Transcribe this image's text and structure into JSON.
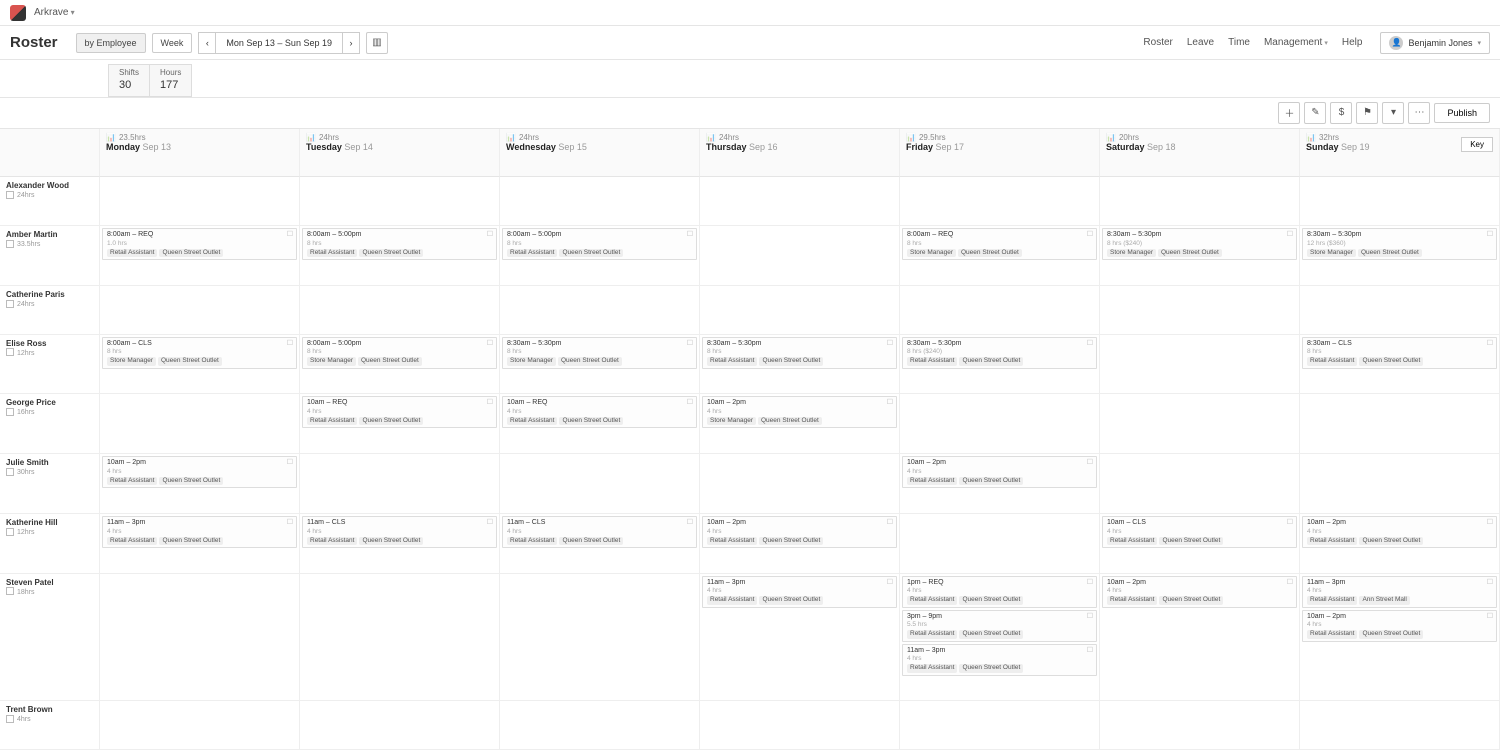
{
  "app": {
    "org": "Arkrave"
  },
  "nav": {
    "title": "Roster",
    "view_by": "by Employee",
    "period": "Week",
    "range": "Mon Sep 13 – Sun Sep 19",
    "links": [
      "Roster",
      "Leave",
      "Time",
      "Management",
      "Help"
    ],
    "user": "Benjamin Jones"
  },
  "stats": {
    "shifts_label": "Shifts",
    "shifts": "30",
    "hours_label": "Hours",
    "hours": "177"
  },
  "toolbar": {
    "publish": "Publish",
    "key": "Key"
  },
  "days": [
    {
      "hrs": "23.5hrs",
      "name": "Monday",
      "date": "Sep 13"
    },
    {
      "hrs": "24hrs",
      "name": "Tuesday",
      "date": "Sep 14"
    },
    {
      "hrs": "24hrs",
      "name": "Wednesday",
      "date": "Sep 15"
    },
    {
      "hrs": "24hrs",
      "name": "Thursday",
      "date": "Sep 16"
    },
    {
      "hrs": "29.5hrs",
      "name": "Friday",
      "date": "Sep 17"
    },
    {
      "hrs": "20hrs",
      "name": "Saturday",
      "date": "Sep 18"
    },
    {
      "hrs": "32hrs",
      "name": "Sunday",
      "date": "Sep 19"
    }
  ],
  "employees": [
    {
      "name": "Alexander Wood",
      "hrs": "24hrs"
    },
    {
      "name": "Amber Martin",
      "hrs": "33.5hrs"
    },
    {
      "name": "Catherine Paris",
      "hrs": "24hrs"
    },
    {
      "name": "Elise Ross",
      "hrs": "12hrs"
    },
    {
      "name": "George Price",
      "hrs": "16hrs"
    },
    {
      "name": "Julie Smith",
      "hrs": "30hrs"
    },
    {
      "name": "Katherine Hill",
      "hrs": "12hrs"
    },
    {
      "name": "Steven Patel",
      "hrs": "18hrs"
    },
    {
      "name": "Trent Brown",
      "hrs": "4hrs"
    }
  ],
  "tags": {
    "ra": "Retail Assistant",
    "sm": "Store Manager",
    "qso": "Queen Street Outlet",
    "asm": "Ann Street Mall"
  },
  "shifts": {
    "r0": [
      null,
      null,
      null,
      null,
      null,
      null,
      null
    ],
    "r1": [
      {
        "time": "8:00am – REQ",
        "dur": "1.0 hrs",
        "tags": [
          "ra",
          "qso"
        ]
      },
      {
        "time": "8:00am – 5:00pm",
        "dur": "8 hrs",
        "tags": [
          "ra",
          "qso"
        ]
      },
      {
        "time": "8:00am – 5:00pm",
        "dur": "8 hrs",
        "tags": [
          "ra",
          "qso"
        ]
      },
      null,
      {
        "time": "8:00am – REQ",
        "dur": "8 hrs",
        "tags": [
          "sm",
          "qso"
        ]
      },
      {
        "time": "8:30am – 5:30pm",
        "dur": "8 hrs ($240)",
        "tags": [
          "sm",
          "qso"
        ]
      },
      {
        "time": "8:30am – 5:30pm",
        "dur": "12 hrs ($360)",
        "tags": [
          "sm",
          "qso"
        ]
      }
    ],
    "r2": [
      null,
      null,
      null,
      null,
      null,
      null,
      null
    ],
    "r3": [
      {
        "time": "8:00am – CLS",
        "dur": "8 hrs",
        "tags": [
          "sm",
          "qso"
        ]
      },
      {
        "time": "8:00am – 5:00pm",
        "dur": "8 hrs",
        "tags": [
          "sm",
          "qso"
        ]
      },
      {
        "time": "8:30am – 5:30pm",
        "dur": "8 hrs",
        "tags": [
          "sm",
          "qso"
        ]
      },
      {
        "time": "8:30am – 5:30pm",
        "dur": "8 hrs",
        "tags": [
          "ra",
          "qso"
        ]
      },
      {
        "time": "8:30am – 5:30pm",
        "dur": "8 hrs ($240)",
        "tags": [
          "ra",
          "qso"
        ]
      },
      null,
      {
        "time": "8:30am – CLS",
        "dur": "8 hrs",
        "tags": [
          "ra",
          "qso"
        ]
      }
    ],
    "r4": [
      null,
      {
        "time": "10am – REQ",
        "dur": "4 hrs",
        "tags": [
          "ra",
          "qso"
        ]
      },
      {
        "time": "10am – REQ",
        "dur": "4 hrs",
        "tags": [
          "ra",
          "qso"
        ]
      },
      {
        "time": "10am – 2pm",
        "dur": "4 hrs",
        "tags": [
          "sm",
          "qso"
        ]
      },
      null,
      null,
      null
    ],
    "r5": [
      {
        "time": "10am – 2pm",
        "dur": "4 hrs",
        "tags": [
          "ra",
          "qso"
        ]
      },
      null,
      null,
      null,
      {
        "time": "10am – 2pm",
        "dur": "4 hrs",
        "tags": [
          "ra",
          "qso"
        ]
      },
      null,
      null
    ],
    "r6": [
      {
        "time": "11am – 3pm",
        "dur": "4 hrs",
        "tags": [
          "ra",
          "qso"
        ]
      },
      {
        "time": "11am – CLS",
        "dur": "4 hrs",
        "tags": [
          "ra",
          "qso"
        ]
      },
      {
        "time": "11am – CLS",
        "dur": "4 hrs",
        "tags": [
          "ra",
          "qso"
        ]
      },
      {
        "time": "10am – 2pm",
        "dur": "4 hrs",
        "tags": [
          "ra",
          "qso"
        ]
      },
      null,
      {
        "time": "10am – CLS",
        "dur": "4 hrs",
        "tags": [
          "ra",
          "qso"
        ]
      },
      {
        "time": "10am – 2pm",
        "dur": "4 hrs",
        "tags": [
          "ra",
          "qso"
        ]
      }
    ],
    "r7": [
      null,
      null,
      null,
      {
        "time": "11am – 3pm",
        "dur": "4 hrs",
        "tags": [
          "ra",
          "qso"
        ]
      },
      [
        {
          "time": "1pm – REQ",
          "dur": "4 hrs",
          "tags": [
            "ra",
            "qso"
          ]
        },
        {
          "time": "3pm – 9pm",
          "dur": "5.5 hrs",
          "tags": [
            "ra",
            "qso"
          ]
        },
        {
          "time": "11am – 3pm",
          "dur": "4 hrs",
          "tags": [
            "ra",
            "qso"
          ]
        }
      ],
      {
        "time": "10am – 2pm",
        "dur": "4 hrs",
        "tags": [
          "ra",
          "qso"
        ]
      },
      [
        {
          "time": "11am – 3pm",
          "dur": "4 hrs",
          "tags": [
            "ra",
            "asm"
          ]
        },
        {
          "time": "10am – 2pm",
          "dur": "4 hrs",
          "tags": [
            "ra",
            "qso"
          ]
        }
      ]
    ],
    "r8": [
      null,
      null,
      null,
      null,
      null,
      null,
      null
    ]
  }
}
